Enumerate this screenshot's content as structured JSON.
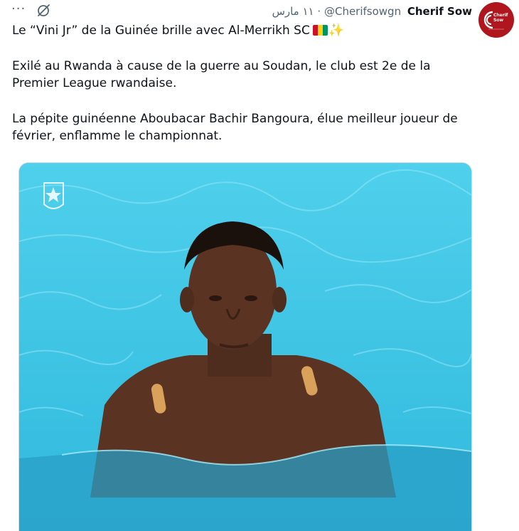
{
  "header": {
    "more_label": "···",
    "grok_icon": "grok-icon",
    "date": "١١ مارس",
    "separator": "·",
    "handle": "@Cherifsowgn",
    "display_name": "Cherif Sow"
  },
  "avatar": {
    "line1": "Cherif",
    "line2": "Sow",
    "color": "#b0161d"
  },
  "tweet": {
    "line1": "Le “Vini Jr” de la Guinée brille avec Al-Merrikh SC",
    "flag_colors": [
      "#ce1126",
      "#fcd116",
      "#009460"
    ],
    "sparkle": "✨",
    "paragraph2": "Exilé au Rwanda à cause de la guerre au Soudan, le club est 2e de la Premier League rwandaise.",
    "paragraph3": "La pépite guinéenne Aboubacar Bachir Bangoura, élue meilleur joueur de février, enflamme le championnat."
  },
  "media": {
    "pool_color": "#3fc9e6",
    "skin_color": "#5a3322"
  }
}
